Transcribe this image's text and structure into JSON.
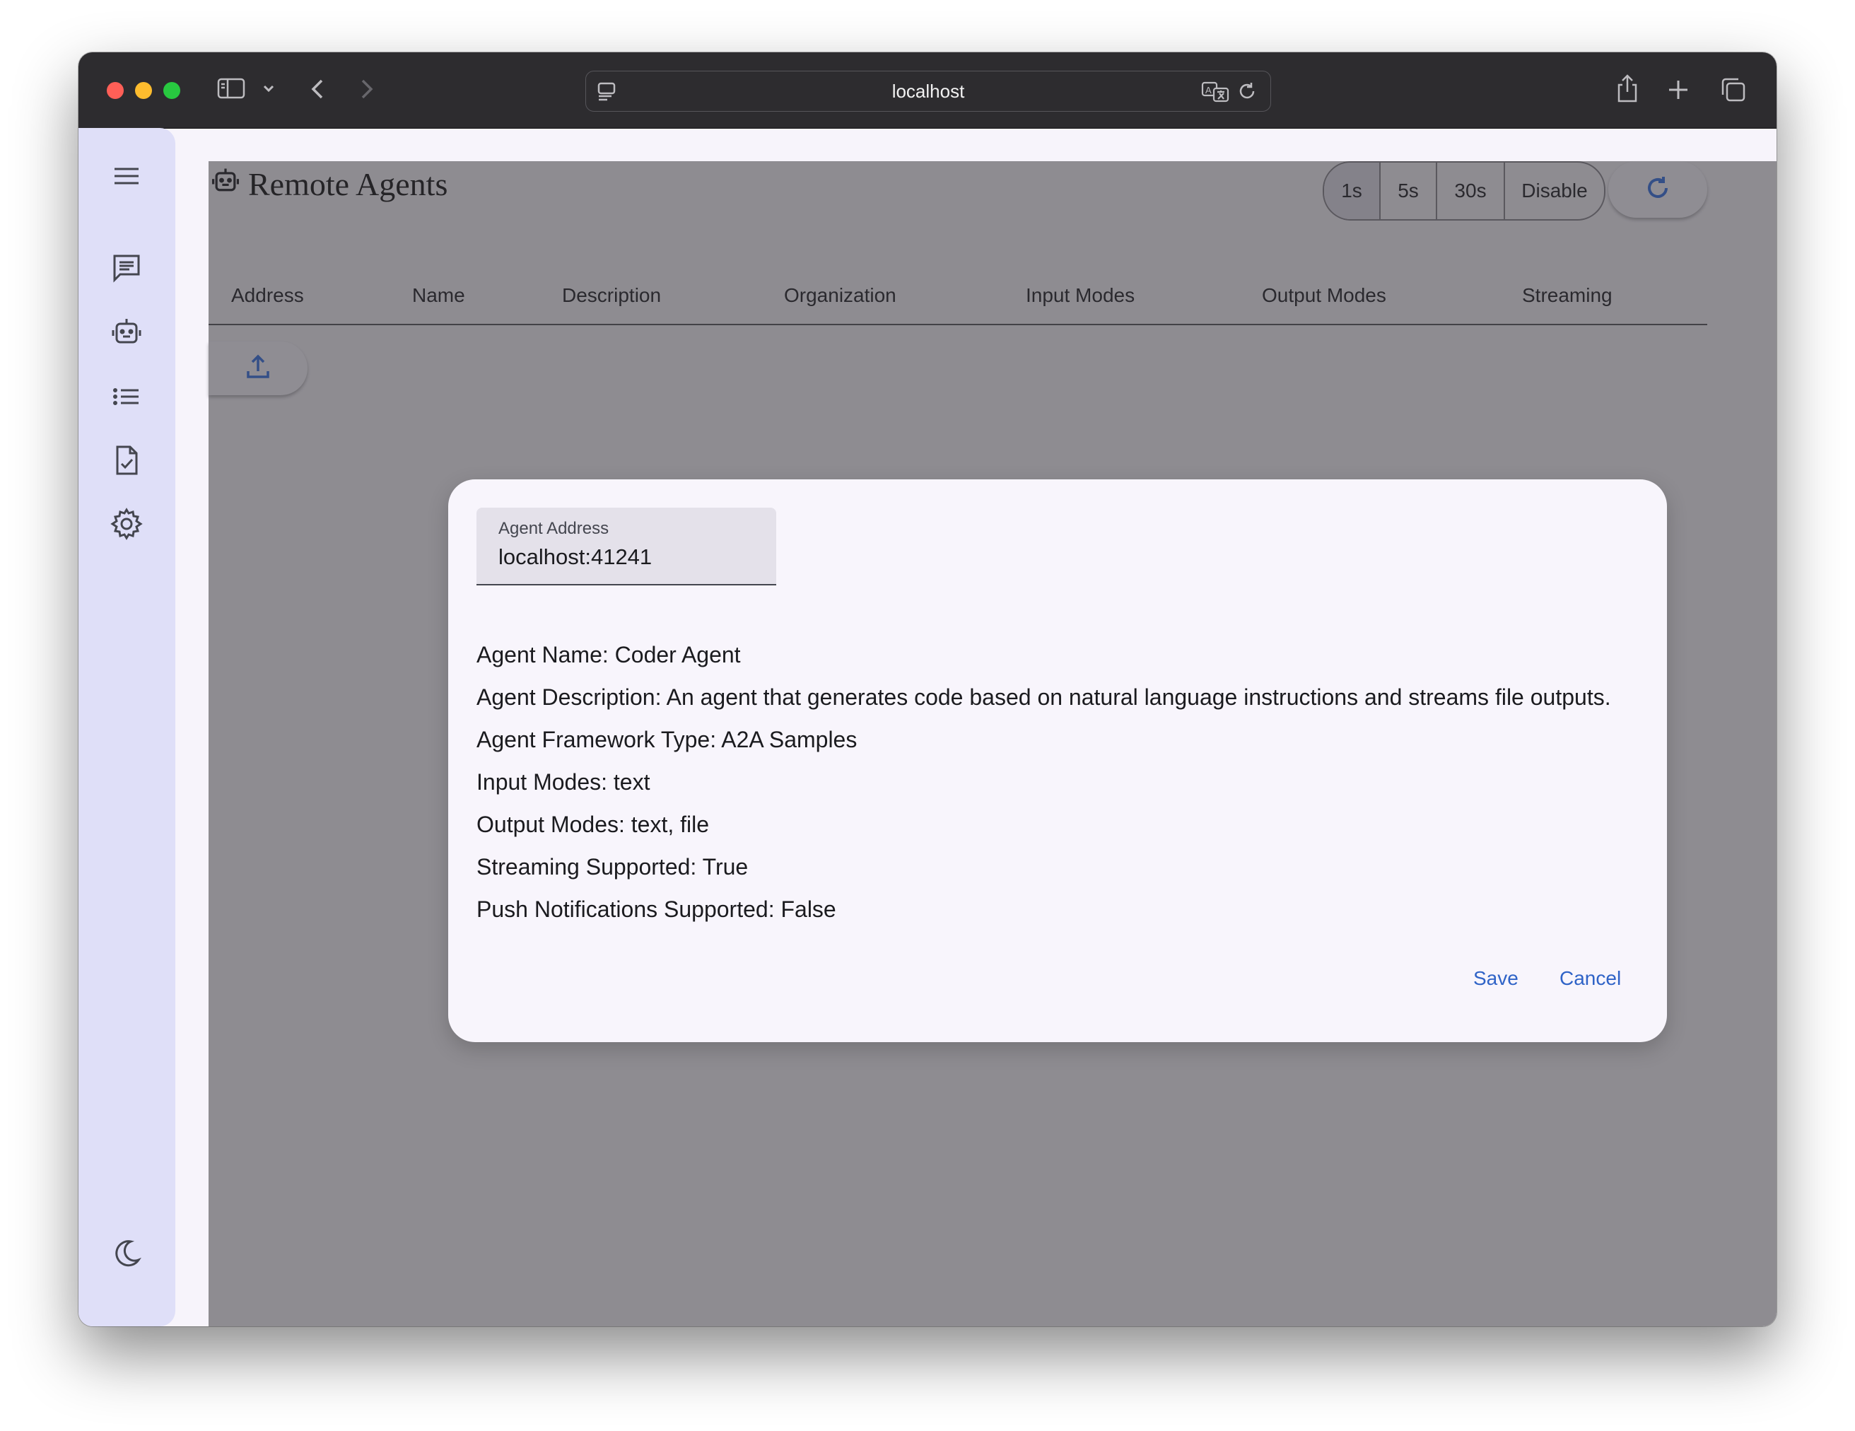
{
  "browser": {
    "url": "localhost"
  },
  "sidebar": {
    "items": [
      {
        "icon": "menu-icon"
      },
      {
        "icon": "chat-icon"
      },
      {
        "icon": "robot-icon"
      },
      {
        "icon": "list-icon"
      },
      {
        "icon": "task-icon"
      },
      {
        "icon": "gear-icon"
      }
    ],
    "footer_icon": "moon-icon"
  },
  "page": {
    "title": "Remote Agents",
    "refresh_options": [
      "1s",
      "5s",
      "30s",
      "Disable"
    ],
    "selected_refresh": "1s"
  },
  "table": {
    "columns": [
      "Address",
      "Name",
      "Description",
      "Organization",
      "Input Modes",
      "Output Modes",
      "Streaming"
    ]
  },
  "dialog": {
    "field_label": "Agent Address",
    "field_value": "localhost:41241",
    "lines": [
      "Agent Name: Coder Agent",
      "Agent Description: An agent that generates code based on natural language instructions and streams file outputs.",
      "Agent Framework Type: A2A Samples",
      "Input Modes: text",
      "Output Modes: text, file",
      "Streaming Supported: True",
      "Push Notifications Supported: False"
    ],
    "save_label": "Save",
    "cancel_label": "Cancel"
  },
  "colors": {
    "accent": "#2f63c7",
    "sidebar_bg": "#dfdff8",
    "titlebar_bg": "#2d2c2f"
  }
}
